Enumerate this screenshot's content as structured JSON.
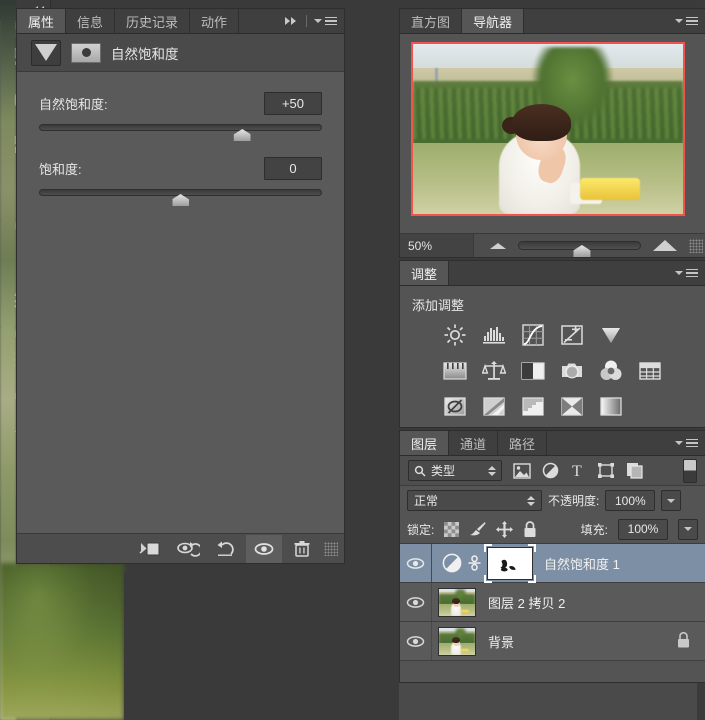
{
  "app": "Adobe Photoshop",
  "properties_panel": {
    "tabs": [
      {
        "label": "属性",
        "active": true
      },
      {
        "label": "信息",
        "active": false
      },
      {
        "label": "历史记录",
        "active": false
      },
      {
        "label": "动作",
        "active": false
      }
    ],
    "header": {
      "adjustment_icon": "vibrance-triangle-icon",
      "mask_icon": "layer-mask-icon",
      "title": "自然饱和度"
    },
    "controls": [
      {
        "label": "自然饱和度:",
        "value": "+50",
        "slider_percent": 72
      },
      {
        "label": "饱和度:",
        "value": "0",
        "slider_percent": 50
      }
    ],
    "footer_buttons": [
      {
        "name": "clip-to-layer-icon",
        "active": false
      },
      {
        "name": "preview-eye-loop-icon",
        "active": false
      },
      {
        "name": "reset-icon",
        "active": false
      },
      {
        "name": "toggle-visibility-eye-icon",
        "active": true
      },
      {
        "name": "delete-trash-icon",
        "active": false
      }
    ]
  },
  "icon_strip": {
    "collapse_label": "collapse-panel-double-arrow",
    "groups": [
      {
        "items": [
          {
            "name": "3d-panel-icon",
            "selected": true
          },
          {
            "name": "info-circle-icon",
            "selected": false
          },
          {
            "name": "history-undo-icon",
            "selected": false
          },
          {
            "name": "actions-play-icon",
            "selected": false
          }
        ]
      },
      {
        "items": [
          {
            "name": "brushes-jar-icon",
            "selected": false
          },
          {
            "name": "brush-presets-icon",
            "selected": false
          }
        ]
      },
      {
        "items": [
          {
            "name": "clone-source-stamp-icon",
            "selected": false
          }
        ]
      },
      {
        "items": [
          {
            "name": "character-A-icon",
            "selected": false
          },
          {
            "name": "paragraph-pilcrow-icon",
            "selected": false
          }
        ]
      }
    ]
  },
  "navigator_panel": {
    "tabs": [
      {
        "label": "直方图",
        "active": false
      },
      {
        "label": "导航器",
        "active": true
      }
    ],
    "view_box_color": "#f2534d",
    "zoom_value": "50%",
    "zoom_slider_percent": 52,
    "zoom_out_icon": "small-mountain-icon",
    "zoom_in_icon": "large-mountain-icon"
  },
  "adjustments_panel": {
    "tabs": [
      {
        "label": "调整",
        "active": true
      }
    ],
    "subtitle": "添加调整",
    "rows": [
      [
        {
          "name": "brightness-contrast-icon"
        },
        {
          "name": "levels-icon"
        },
        {
          "name": "curves-icon"
        },
        {
          "name": "exposure-icon"
        },
        {
          "name": "vibrance-icon"
        }
      ],
      [
        {
          "name": "hue-saturation-icon"
        },
        {
          "name": "color-balance-icon"
        },
        {
          "name": "black-white-icon"
        },
        {
          "name": "photo-filter-icon"
        },
        {
          "name": "channel-mixer-icon"
        },
        {
          "name": "color-lookup-icon"
        }
      ],
      [
        {
          "name": "invert-icon"
        },
        {
          "name": "posterize-icon"
        },
        {
          "name": "threshold-icon"
        },
        {
          "name": "selective-color-icon"
        },
        {
          "name": "gradient-map-icon"
        }
      ]
    ]
  },
  "layers_panel": {
    "tabs": [
      {
        "label": "图层",
        "active": true
      },
      {
        "label": "通道",
        "active": false
      },
      {
        "label": "路径",
        "active": false
      }
    ],
    "filter": {
      "kind_label": "类型",
      "search_icon": "search-magnifier-icon",
      "filter_icons": [
        {
          "name": "filter-pixel-icon"
        },
        {
          "name": "filter-adjustment-icon"
        },
        {
          "name": "filter-type-icon"
        },
        {
          "name": "filter-shape-icon"
        },
        {
          "name": "filter-smart-object-icon"
        }
      ],
      "toggle_name": "filter-enable-toggle"
    },
    "blend": {
      "mode": "正常",
      "opacity_label": "不透明度:",
      "opacity_value": "100%"
    },
    "lock": {
      "label": "锁定:",
      "icons": [
        {
          "name": "lock-transparency-icon"
        },
        {
          "name": "lock-image-pixels-brush-icon"
        },
        {
          "name": "lock-position-move-icon"
        },
        {
          "name": "lock-all-padlock-icon"
        }
      ],
      "fill_label": "填充:",
      "fill_value": "100%"
    },
    "layers": [
      {
        "name": "自然饱和度 1",
        "visible": true,
        "selected": true,
        "type": "adjustment",
        "has_mask": true,
        "linked": true,
        "locked": false
      },
      {
        "name": "图层 2 拷贝 2",
        "visible": true,
        "selected": false,
        "type": "pixel",
        "has_mask": false,
        "linked": false,
        "locked": false
      },
      {
        "name": "背景",
        "visible": true,
        "selected": false,
        "type": "pixel",
        "has_mask": false,
        "linked": false,
        "locked": true
      }
    ]
  }
}
